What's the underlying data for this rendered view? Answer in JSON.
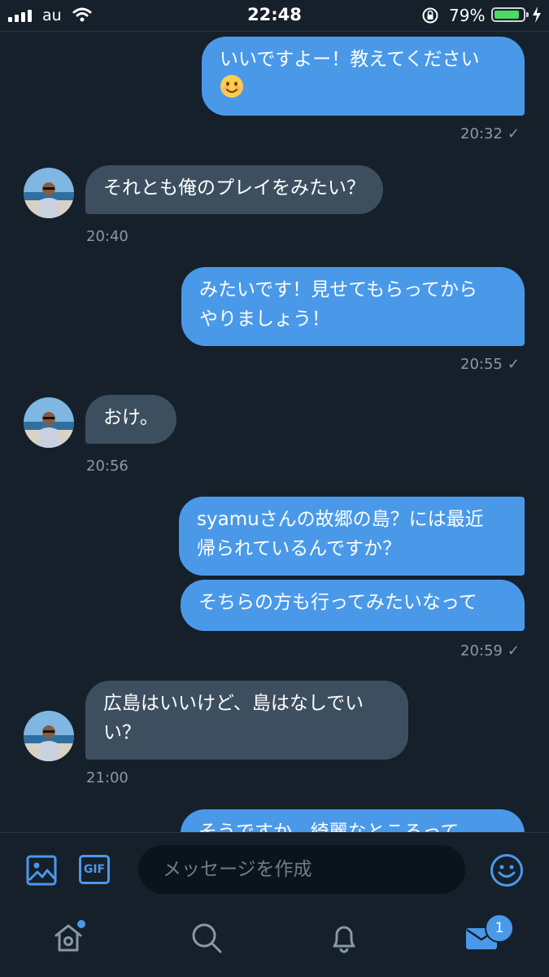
{
  "status_bar": {
    "carrier": "au",
    "time": "22:48",
    "battery_percent": "79%",
    "battery_level": 0.79
  },
  "messages": [
    {
      "type": "sent",
      "text_line1": "いいですよー！教えてください",
      "emoji": "smiling-face-emoji",
      "time": "20:32",
      "read_mark": "✓"
    },
    {
      "type": "received",
      "text": "それとも俺のプレイをみたい？",
      "time": "20:40"
    },
    {
      "type": "sent",
      "text_line1": "みたいです！見せてもらってから",
      "text_line2": "やりましょう！",
      "time": "20:55",
      "read_mark": "✓"
    },
    {
      "type": "received",
      "text": "おけ。",
      "time": "20:56"
    },
    {
      "type": "sent",
      "text_line1": "syamuさんの故郷の島？には最近",
      "text_line2": "帰られているんですか？"
    },
    {
      "type": "sent",
      "text": "そちらの方も行ってみたいなって",
      "time": "20:59",
      "read_mark": "✓"
    },
    {
      "type": "received",
      "text_line1": "広島はいいけど、島はなしでい",
      "text_line2": "い？",
      "time": "21:00"
    },
    {
      "type": "sent",
      "text_partial": "そうですか、綺麗なところって"
    }
  ],
  "composer": {
    "placeholder": "メッセージを作成",
    "gif_label": "GIF",
    "icons": [
      "image-icon",
      "gif-icon",
      "emoji-icon"
    ]
  },
  "tab_bar": {
    "tabs": [
      "home-icon",
      "search-icon",
      "notifications-icon",
      "messages-icon"
    ],
    "messages_badge": "1"
  },
  "colors": {
    "background": "#15202b",
    "sent_bubble": "#4a99e9",
    "received_bubble": "#3d4f5f",
    "timestamp": "#8899a6",
    "accent": "#4a99e9",
    "battery": "#4cd964"
  }
}
